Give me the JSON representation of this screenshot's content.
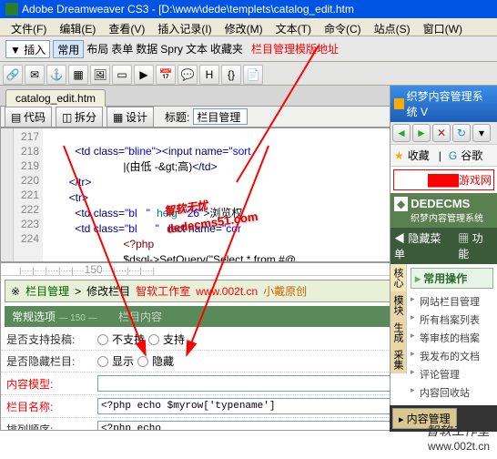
{
  "titlebar": {
    "app": "Adobe Dreamweaver CS3",
    "path": "[D:\\www\\dede\\templets\\catalog_edit.htm"
  },
  "menubar": {
    "file": "文件(F)",
    "edit": "编辑(E)",
    "view": "查看(V)",
    "insert": "插入记录(I)",
    "modify": "修改(M)",
    "text": "文本(T)",
    "commands": "命令(C)",
    "site": "站点(S)",
    "window": "窗口(W)"
  },
  "toolbar": {
    "insert_dd": "▼ 插入",
    "tabs": [
      "常用",
      "布局",
      "表单",
      "数据",
      "Spry",
      "文本",
      "收藏夹"
    ],
    "red_note": "栏目管理模版地址"
  },
  "tab": {
    "name": "catalog_edit.htm"
  },
  "viewbar": {
    "code": "代码",
    "split": "拆分",
    "design": "设计",
    "title_label": "标题:",
    "title_value": "栏目管理"
  },
  "code": {
    "lines": [
      "217",
      "218",
      "219",
      "220",
      "221",
      "222",
      "223",
      "224"
    ],
    "l217": "<td class=\"bline\"><input name=\"sort",
    "l218": "|(由低 -&gt;高)</td>",
    "l219": "</tr>",
    "l220": "<tr>",
    "l221a": "<td class=\"bl",
    "l221b": "\" heig",
    "l221c": "26\">浏览权",
    "l222a": "<td class=\"bl",
    "l222b": "lect name=\"cor",
    "l223": "<?php",
    "l224": "$dsql->SetQuery(\"Select * from #@_"
  },
  "design": {
    "ruler": "150",
    "breadcrumb": {
      "icon": "※",
      "a": "栏目管理",
      "b": "修改栏目",
      "c": "智软工作室",
      "d": "www.002t.cn",
      "e": "小戴原创"
    },
    "tabs": {
      "a": "常规选项",
      "b": "栏目内容"
    },
    "rows": {
      "r1": {
        "label": "是否支持投稿:",
        "opt1": "不支持",
        "opt2": "支持"
      },
      "r2": {
        "label": "是否隐藏栏目:",
        "opt1": "显示",
        "opt2": "隐藏"
      },
      "r3": {
        "label": "内容模型:"
      },
      "r4": {
        "label": "栏目名称:",
        "value": "<?php echo $myrow['typename']"
      },
      "r5": {
        "label": "排列顺序:",
        "value": "<?php echo"
      }
    }
  },
  "right": {
    "title": "织梦内容管理系统 V",
    "fav": "收藏",
    "google": "谷歌",
    "banner": "游戏网",
    "logo": {
      "big": "DEDECMS",
      "sub": "织梦内容管理系统"
    },
    "menu": {
      "a": "隐藏菜单",
      "b": "功能"
    },
    "sidecol": [
      "核心",
      "模块",
      "生成",
      "采集"
    ],
    "section": "常用操作",
    "items": [
      "网站栏目管理",
      "所有档案列表",
      "等审核的档案",
      "我发布的文档",
      "评论管理",
      "内容回收站"
    ],
    "foot": "内容管理"
  },
  "watermark": {
    "main": "智软无忧",
    "sub": "dedecms51.com"
  },
  "footer": {
    "cn": "智软工作室",
    "url": "www.002t.cn"
  }
}
